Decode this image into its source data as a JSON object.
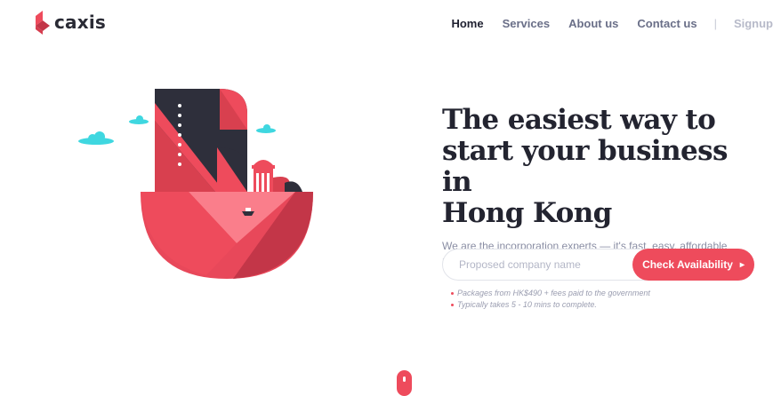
{
  "brand": {
    "name": "caxis",
    "accent": "#ee4b5c",
    "dark": "#2a2b35"
  },
  "nav": {
    "items": [
      {
        "label": "Home",
        "active": true
      },
      {
        "label": "Services"
      },
      {
        "label": "About us"
      },
      {
        "label": "Contact us"
      }
    ],
    "separator": "|",
    "signup": "Signup"
  },
  "hero": {
    "title_line1": "The easiest way to",
    "title_line2": "start your business in",
    "title_line3": "Hong Kong",
    "subtitle": "We are the incorporation experts — it's fast, easy, affordable and done right."
  },
  "search": {
    "placeholder": "Proposed company name",
    "value": "",
    "button_label": "Check Availability",
    "button_icon": "chevron-right-icon"
  },
  "notes": [
    "Packages from HK$490 + fees paid to the government",
    "Typically takes 5 - 10 mins to complete."
  ],
  "icons": {
    "logo": "caxis-logo-mark",
    "scroll": "mouse-scroll-icon"
  }
}
